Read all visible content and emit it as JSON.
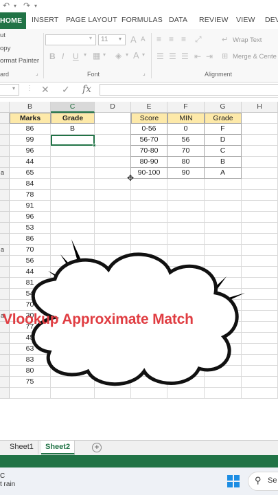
{
  "ribbon": {
    "tabs": [
      "HOME",
      "INSERT",
      "PAGE LAYOUT",
      "FORMULAS",
      "DATA",
      "REVIEW",
      "VIEW",
      "DEV"
    ],
    "clipboard": {
      "cut": "ut",
      "copy": "opy",
      "format_painter": "ormat Painter",
      "group": "ard"
    },
    "font": {
      "font_size": "11",
      "group": "Font"
    },
    "alignment": {
      "wrap_text": "Wrap Text",
      "merge_center": "Merge & Cente",
      "group": "Alignment"
    }
  },
  "formula_bar": {
    "fx": "fx"
  },
  "columns": [
    "B",
    "C",
    "D",
    "E",
    "F",
    "G",
    "H"
  ],
  "row_labels": [
    "a",
    "a",
    "a"
  ],
  "marks_table": {
    "header": [
      "Marks",
      "Grade"
    ],
    "marks": [
      86,
      99,
      96,
      44,
      65,
      84,
      78,
      91,
      96,
      53,
      86,
      70,
      56,
      44,
      81,
      54,
      70,
      30,
      77,
      45,
      63,
      83,
      80,
      75
    ],
    "first_grade": "B"
  },
  "lookup_table": {
    "header": [
      "Score",
      "MIN",
      "Grade"
    ],
    "rows": [
      [
        "0-56",
        "0",
        "F"
      ],
      [
        "56-70",
        "56",
        "D"
      ],
      [
        "70-80",
        "70",
        "C"
      ],
      [
        "80-90",
        "80",
        "B"
      ],
      [
        "90-100",
        "90",
        "A"
      ]
    ]
  },
  "sheets": [
    "Sheet1",
    "Sheet2"
  ],
  "active_sheet": "Sheet2",
  "callout": "Vlookup Approximate Match",
  "taskbar": {
    "weather_line1": "C",
    "weather_line2": "t rain",
    "search": "Se"
  },
  "colors": {
    "excel_green": "#217346",
    "header_fill": "#fde9a9",
    "callout_text": "#e03d42"
  }
}
